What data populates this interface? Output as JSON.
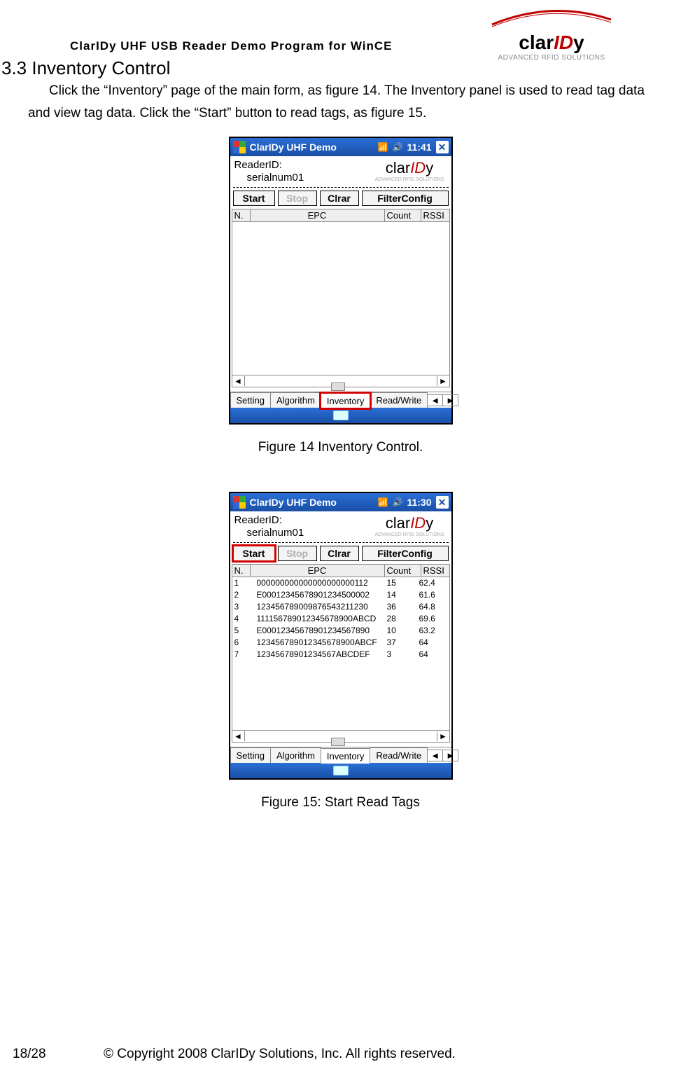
{
  "brand": {
    "clar": "clar",
    "id": "ID",
    "y": "y",
    "tagline": "ADVANCED RFID SOLUTIONS"
  },
  "doc_title": "ClarIDy UHF USB Reader Demo Program for WinCE",
  "section": "3.3 Inventory Control",
  "body": "Click the “Inventory” page of the main form, as figure 14. The Inventory panel is used to read tag data and view tag data. Click the “Start” button to read tags, as figure 15.",
  "fig14": {
    "titlebar": {
      "app": "ClarIDy UHF Demo",
      "time": "11:41"
    },
    "reader_label": "ReaderID:",
    "reader_value": "serialnum01",
    "buttons": {
      "start": "Start",
      "stop": "Stop",
      "clrar": "Clrar",
      "filter": "FilterConfig"
    },
    "cols": {
      "n": "N.",
      "epc": "EPC",
      "count": "Count",
      "rssi": "RSSI"
    },
    "tabs": {
      "setting": "Setting",
      "algorithm": "Algorithm",
      "inventory": "Inventory",
      "rw": "Read/Write"
    },
    "caption": "Figure 14 Inventory Control."
  },
  "fig15": {
    "titlebar": {
      "app": "ClarIDy UHF Demo",
      "time": "11:30"
    },
    "reader_label": "ReaderID:",
    "reader_value": "serialnum01",
    "buttons": {
      "start": "Start",
      "stop": "Stop",
      "clrar": "Clrar",
      "filter": "FilterConfig"
    },
    "cols": {
      "n": "N.",
      "epc": "EPC",
      "count": "Count",
      "rssi": "RSSI"
    },
    "rows": [
      {
        "n": "1",
        "epc": "000000000000000000000112",
        "count": "15",
        "rssi": "62.4"
      },
      {
        "n": "2",
        "epc": "E00012345678901234500002",
        "count": "14",
        "rssi": "61.6"
      },
      {
        "n": "3",
        "epc": "123456789009876543211230",
        "count": "36",
        "rssi": "64.8"
      },
      {
        "n": "4",
        "epc": "111156789012345678900ABCD",
        "count": "28",
        "rssi": "69.6"
      },
      {
        "n": "5",
        "epc": "E00012345678901234567890",
        "count": "10",
        "rssi": "63.2"
      },
      {
        "n": "6",
        "epc": "123456789012345678900ABCF",
        "count": "37",
        "rssi": "64"
      },
      {
        "n": "7",
        "epc": "12345678901234567ABCDEF",
        "count": "3",
        "rssi": "64"
      }
    ],
    "tabs": {
      "setting": "Setting",
      "algorithm": "Algorithm",
      "inventory": "Inventory",
      "rw": "Read/Write"
    },
    "caption": "Figure 15: Start Read Tags"
  },
  "footer": {
    "page": "18/28",
    "copyright": "© Copyright 2008 ClarIDy Solutions, Inc. All rights reserved."
  }
}
